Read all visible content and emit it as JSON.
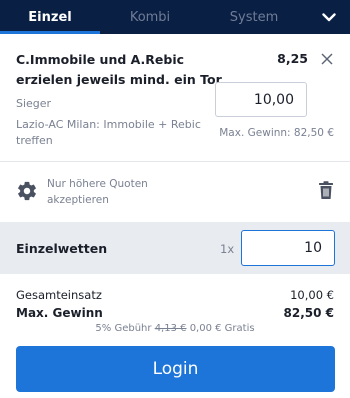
{
  "tabs": {
    "einzel": "Einzel",
    "kombi": "Kombi",
    "system": "System"
  },
  "colors": {
    "header_bg": "#0a1f44",
    "accent": "#1d74d9",
    "muted_text": "#7a8192",
    "row_bg": "#e8ebf0"
  },
  "icons": {
    "collapse": "chevron-down-icon",
    "close": "close-icon",
    "settings": "gear-icon",
    "delete": "trash-icon"
  },
  "bet": {
    "title": "C.Immobile und A.Rebic erzielen jeweils mind. ein Tor",
    "odds": "8,25",
    "market": "Sieger",
    "event": "Lazio-AC Milan: Immobile + Rebic treffen",
    "stake": "10,00",
    "max_win": "Max. Gewinn: 82,50 €"
  },
  "accept_odds": {
    "label": "Nur höhere Quoten akzeptieren"
  },
  "singles": {
    "label": "Einzelwetten",
    "multiplier": "1x",
    "stake": "10"
  },
  "summary": {
    "total_label": "Gesamteinsatz",
    "total_value": "10,00 €",
    "max_win_label": "Max. Gewinn",
    "max_win_value": "82,50 €",
    "fee_prefix": "5% Gebühr",
    "fee_old": "4,13 €",
    "fee_new": "0,00 € Gratis"
  },
  "login_label": "Login"
}
